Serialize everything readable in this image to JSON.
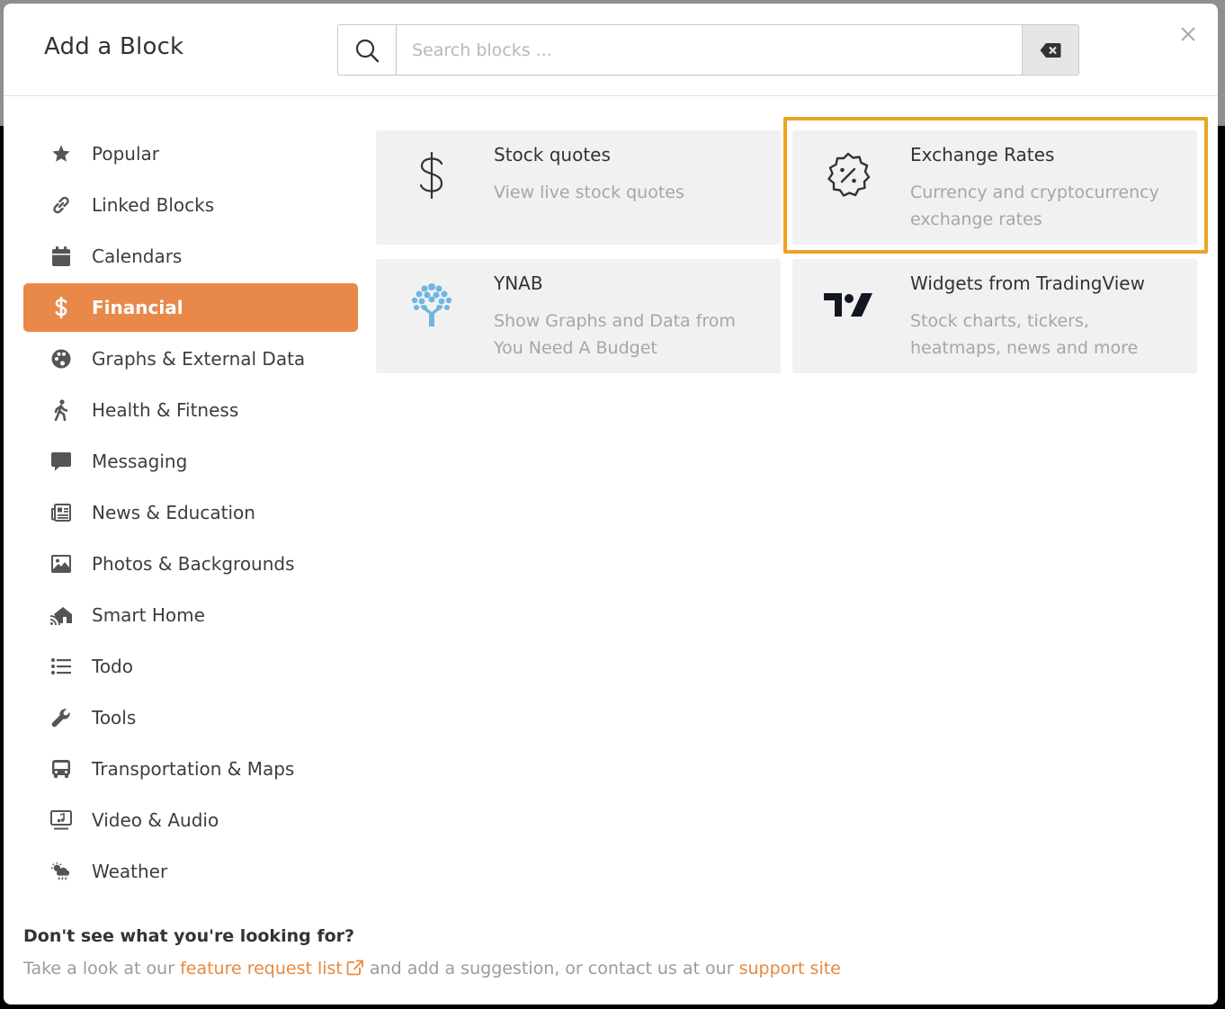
{
  "dialog": {
    "title": "Add a Block",
    "search_placeholder": "Search blocks ...",
    "search_value": ""
  },
  "sidebar": {
    "items": [
      {
        "label": "Popular",
        "icon": "star-icon"
      },
      {
        "label": "Linked Blocks",
        "icon": "link-icon"
      },
      {
        "label": "Calendars",
        "icon": "calendar-icon"
      },
      {
        "label": "Financial",
        "icon": "dollar-icon",
        "active": true
      },
      {
        "label": "Graphs & External Data",
        "icon": "palette-icon"
      },
      {
        "label": "Health & Fitness",
        "icon": "walking-icon"
      },
      {
        "label": "Messaging",
        "icon": "message-icon"
      },
      {
        "label": "News & Education",
        "icon": "newspaper-icon"
      },
      {
        "label": "Photos & Backgrounds",
        "icon": "image-icon"
      },
      {
        "label": "Smart Home",
        "icon": "smart-home-icon"
      },
      {
        "label": "Todo",
        "icon": "list-icon"
      },
      {
        "label": "Tools",
        "icon": "wrench-icon"
      },
      {
        "label": "Transportation & Maps",
        "icon": "bus-icon"
      },
      {
        "label": "Video & Audio",
        "icon": "tv-music-icon"
      },
      {
        "label": "Weather",
        "icon": "weather-icon"
      }
    ]
  },
  "blocks": [
    {
      "title": "Stock quotes",
      "description": "View live stock quotes",
      "icon": "dollar-sign-icon"
    },
    {
      "title": "Exchange Rates",
      "description": "Currency and cryptocurrency exchange rates",
      "icon": "percent-badge-icon",
      "highlighted": true
    },
    {
      "title": "YNAB",
      "description": "Show Graphs and Data from You Need A Budget",
      "icon": "ynab-tree-icon"
    },
    {
      "title": "Widgets from TradingView",
      "description": "Stock charts, tickers, heatmaps, news and more",
      "icon": "tradingview-logo-icon"
    }
  ],
  "footer": {
    "question": "Don't see what you're looking for?",
    "text_before": "Take a look at our ",
    "link1": "feature request list",
    "text_middle": " and add a suggestion, or contact us at our ",
    "link2": "support site"
  },
  "colors": {
    "accent": "#e8894a",
    "highlight": "#eaa523",
    "ynab_blue": "#6fb5e2"
  }
}
